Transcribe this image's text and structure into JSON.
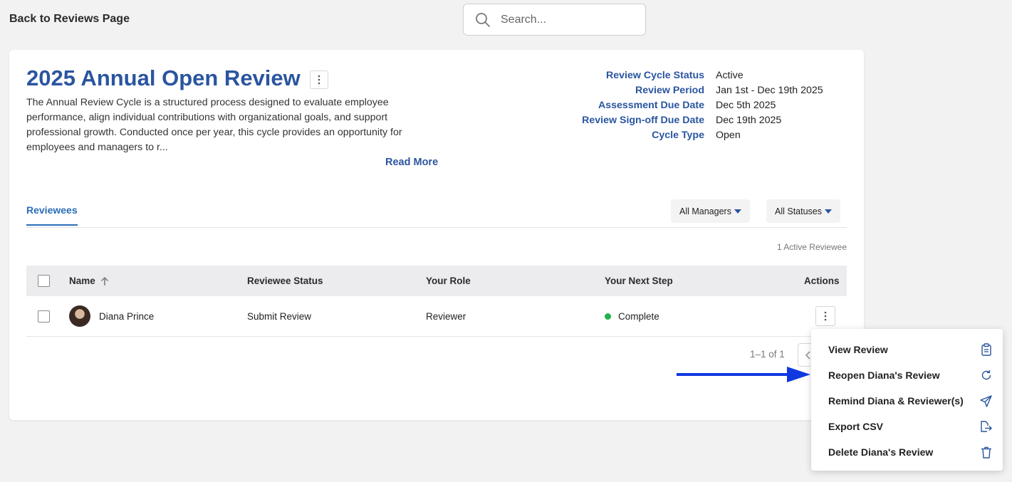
{
  "header": {
    "back_label": "Back to Reviews Page",
    "search_placeholder": "Search..."
  },
  "cycle": {
    "title": "2025 Annual Open Review",
    "description": "The Annual Review Cycle is a structured process designed to evaluate employee performance, align individual contributions with organizational goals, and support professional growth. Conducted once per year, this cycle provides an opportunity for employees and managers to r...",
    "read_more_label": "Read More",
    "meta": [
      {
        "label": "Review Cycle Status",
        "value": "Active"
      },
      {
        "label": "Review Period",
        "value": "Jan 1st - Dec 19th 2025"
      },
      {
        "label": "Assessment Due Date",
        "value": "Dec 5th 2025"
      },
      {
        "label": "Review Sign-off Due Date",
        "value": "Dec 19th 2025"
      },
      {
        "label": "Cycle Type",
        "value": "Open"
      }
    ]
  },
  "tabs": [
    {
      "label": "Reviewees",
      "active": true
    }
  ],
  "filters": {
    "managers_label": "All Managers",
    "statuses_label": "All Statuses"
  },
  "active_count_label": "1 Active Reviewee",
  "table": {
    "columns": [
      "Name",
      "Reviewee Status",
      "Your Role",
      "Your Next Step",
      "Actions"
    ],
    "rows": [
      {
        "name": "Diana Prince",
        "status": "Submit Review",
        "role": "Reviewer",
        "next_step": "Complete"
      }
    ]
  },
  "pagination": {
    "label": "1–1 of 1"
  },
  "action_menu": {
    "items": [
      {
        "label": "View Review",
        "icon": "clipboard-icon"
      },
      {
        "label": "Reopen Diana's Review",
        "icon": "refresh-icon"
      },
      {
        "label": "Remind Diana & Reviewer(s)",
        "icon": "send-icon"
      },
      {
        "label": "Export CSV",
        "icon": "export-file-icon"
      },
      {
        "label": "Delete Diana's Review",
        "icon": "trash-icon"
      }
    ]
  },
  "colors": {
    "primary_blue": "#2a55a0",
    "status_green": "#22b14c",
    "annotation_arrow": "#1038e0"
  }
}
